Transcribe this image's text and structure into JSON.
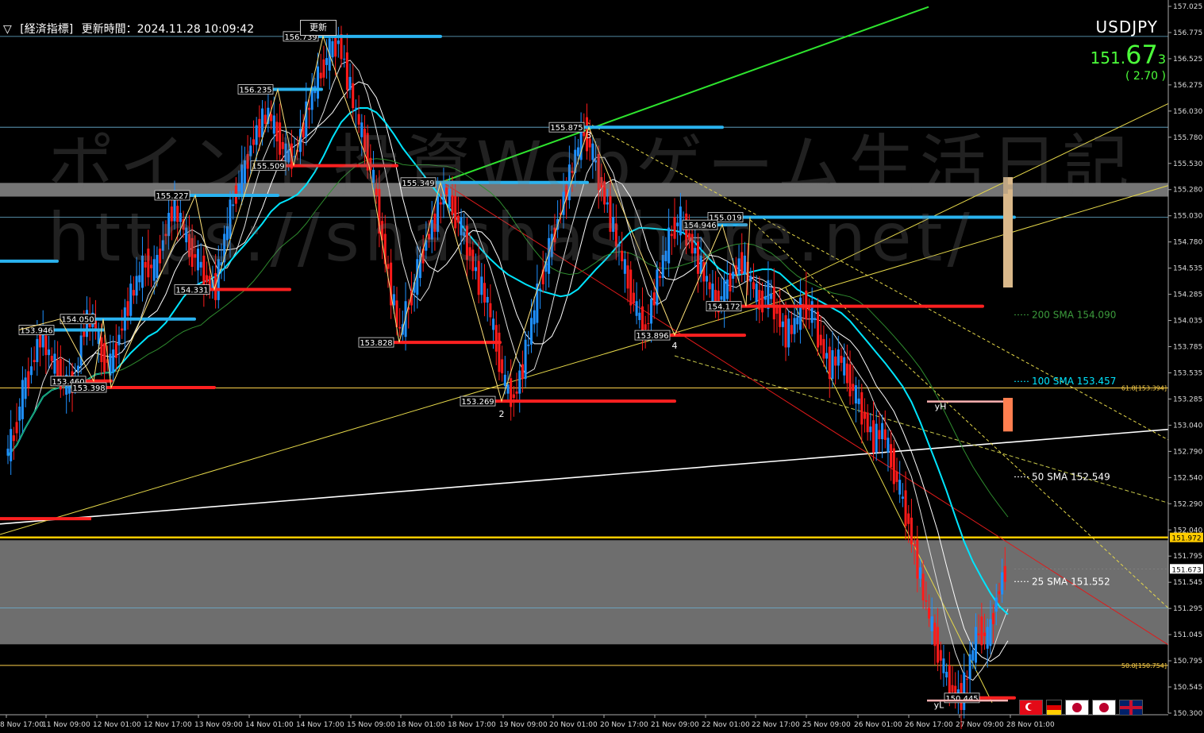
{
  "header": {
    "triangle": "▽",
    "indicator_label": "[経済指標]",
    "update_label": "更新時間：2024.11.28 10:09:42",
    "update_button": "更新"
  },
  "symbol": {
    "name": "USDJPY",
    "price_big": "151.",
    "price_main": "67",
    "price_small": "3",
    "change": "( 2.70 )"
  },
  "watermark": {
    "line1": "ポイント投資Webゲーム生活日記",
    "line2": "https://shashashare.net/"
  },
  "colors": {
    "background": "#000000",
    "bull": "#1e90ff",
    "bear": "#ff1a1a",
    "sma25": "#ffffff",
    "sma100": "#00e5ff",
    "sma200": "#2e8b2e",
    "fib": "#ffd24a",
    "resistance_line": "#ffcc00",
    "zone": "#808080"
  },
  "sma_labels": {
    "sma200": "200 SMA 154.090",
    "sma100": "100 SMA 153.457",
    "sma50": "50 SMA 152.549",
    "sma25": "25 SMA 151.552"
  },
  "fib_labels": {
    "f618": "61.8[153.394]",
    "f500": "50.0[150.754]"
  },
  "right_tags": {
    "resistance": "151.972",
    "current": "151.673"
  },
  "markers": {
    "yH": "yH",
    "yL": "yL",
    "wave2": "2",
    "wave3": "3",
    "wave4": "4"
  },
  "price_labels": [
    "156.739",
    "156.235",
    "155.875",
    "155.509",
    "155.349",
    "155.227",
    "155.019",
    "154.946",
    "154.331",
    "154.172",
    "154.050",
    "153.946",
    "153.896",
    "153.828",
    "153.460",
    "153.398",
    "153.269",
    "150.445"
  ],
  "chart_data": {
    "type": "candlestick",
    "symbol": "USDJPY",
    "timeframe": "H1",
    "ylim": [
      150.3,
      157.025
    ],
    "y_ticks": [
      "157.025",
      "156.775",
      "156.525",
      "156.275",
      "156.030",
      "155.780",
      "155.530",
      "155.280",
      "155.030",
      "154.780",
      "154.535",
      "154.285",
      "154.035",
      "153.785",
      "153.535",
      "153.285",
      "153.040",
      "152.790",
      "152.540",
      "152.290",
      "152.040",
      "151.795",
      "151.545",
      "151.295",
      "151.045",
      "150.795",
      "150.545",
      "150.300"
    ],
    "x_ticks": [
      "8 Nov 17:00",
      "11 Nov 09:00",
      "12 Nov 01:00",
      "12 Nov 17:00",
      "13 Nov 09:00",
      "14 Nov 01:00",
      "14 Nov 17:00",
      "15 Nov 09:00",
      "18 Nov 01:00",
      "18 Nov 17:00",
      "19 Nov 09:00",
      "20 Nov 01:00",
      "20 Nov 17:00",
      "21 Nov 09:00",
      "22 Nov 01:00",
      "22 Nov 17:00",
      "25 Nov 09:00",
      "26 Nov 01:00",
      "26 Nov 17:00",
      "27 Nov 09:00",
      "28 Nov 01:00"
    ],
    "close_path": [
      152.75,
      152.95,
      153.35,
      153.6,
      153.9,
      153.7,
      153.55,
      153.4,
      153.5,
      154.0,
      154.05,
      153.7,
      153.6,
      153.9,
      154.2,
      154.4,
      154.6,
      154.5,
      154.8,
      155.1,
      155.0,
      154.7,
      154.6,
      154.4,
      154.35,
      154.8,
      155.2,
      155.4,
      155.7,
      155.9,
      156.0,
      155.8,
      155.6,
      155.6,
      155.9,
      156.2,
      156.4,
      156.6,
      156.7,
      156.35,
      156.0,
      155.7,
      155.35,
      154.8,
      154.3,
      153.9,
      154.2,
      154.5,
      154.8,
      155.0,
      155.3,
      155.1,
      154.9,
      154.65,
      154.4,
      154.2,
      153.8,
      153.4,
      153.3,
      153.6,
      154.0,
      154.4,
      154.7,
      155.0,
      155.3,
      155.6,
      155.85,
      155.6,
      155.3,
      155.0,
      154.7,
      154.4,
      154.1,
      153.95,
      154.3,
      154.6,
      154.9,
      155.0,
      154.8,
      154.6,
      154.4,
      154.2,
      154.3,
      154.5,
      154.6,
      154.4,
      154.2,
      154.3,
      154.1,
      153.9,
      154.0,
      154.2,
      154.1,
      153.8,
      153.6,
      153.7,
      153.5,
      153.3,
      153.1,
      152.9,
      153.0,
      152.7,
      152.4,
      152.1,
      151.7,
      151.3,
      151.0,
      150.7,
      150.5,
      150.45,
      150.8,
      151.1,
      151.0,
      151.4,
      151.67
    ],
    "sma25": 151.552,
    "sma50": 152.549,
    "sma100": 153.457,
    "sma200": 154.09,
    "resistance": 151.972,
    "fib_618": 153.394,
    "fib_500": 150.754,
    "zone_upper": [
      155.215,
      155.345
    ],
    "zone_lower": [
      150.955,
      151.945
    ]
  }
}
